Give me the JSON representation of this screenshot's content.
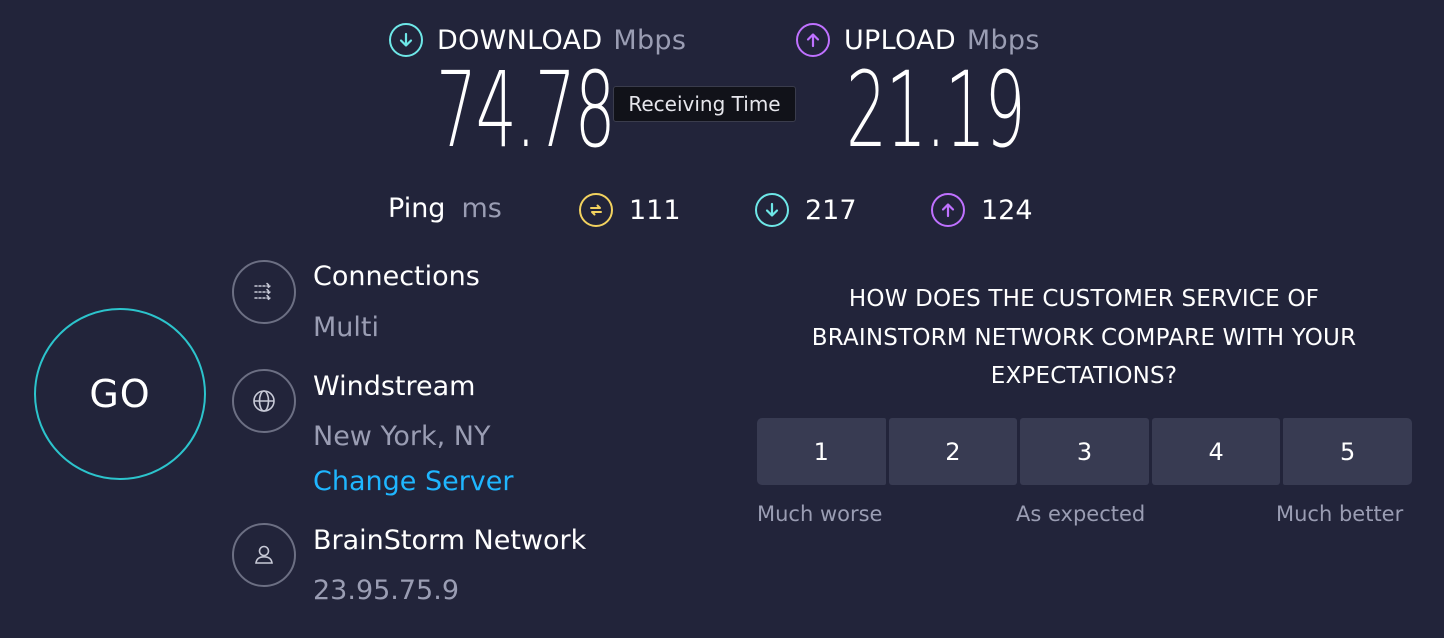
{
  "download": {
    "label": "DOWNLOAD",
    "unit": "Mbps",
    "value": "74.78",
    "icon": "arrow-down-circle-icon",
    "color": "#6ee7e7"
  },
  "upload": {
    "label": "UPLOAD",
    "unit": "Mbps",
    "value": "21.19",
    "icon": "arrow-up-circle-icon",
    "color": "#bf71ff"
  },
  "tooltip": {
    "text": "Receiving Time"
  },
  "ping": {
    "label": "Ping",
    "unit": "ms",
    "idle": {
      "value": "111",
      "icon": "ping-idle-icon",
      "color": "#f2d25f"
    },
    "download": {
      "value": "217",
      "icon": "arrow-down-circle-icon",
      "color": "#6ee7e7"
    },
    "upload": {
      "value": "124",
      "icon": "arrow-up-circle-icon",
      "color": "#bf71ff"
    }
  },
  "go_button": {
    "label": "GO",
    "color": "#2cc4cc"
  },
  "connections": {
    "title": "Connections",
    "value": "Multi",
    "icon": "connections-icon"
  },
  "server": {
    "title": "Windstream",
    "location": "New York, NY",
    "change_label": "Change Server",
    "icon": "globe-icon"
  },
  "provider": {
    "title": "BrainStorm Network",
    "ip": "23.95.75.9",
    "icon": "user-icon"
  },
  "survey": {
    "question_lines": [
      "HOW DOES THE CUSTOMER SERVICE OF",
      "BRAINSTORM NETWORK COMPARE WITH YOUR",
      "EXPECTATIONS?"
    ],
    "ratings": [
      "1",
      "2",
      "3",
      "4",
      "5"
    ],
    "scale_low": "Much worse",
    "scale_mid": "As expected",
    "scale_high": "Much better"
  },
  "colors": {
    "background": "#22243a",
    "muted_text": "#9a9db3",
    "link": "#1fb6ff",
    "rating_button": "#383b52"
  }
}
